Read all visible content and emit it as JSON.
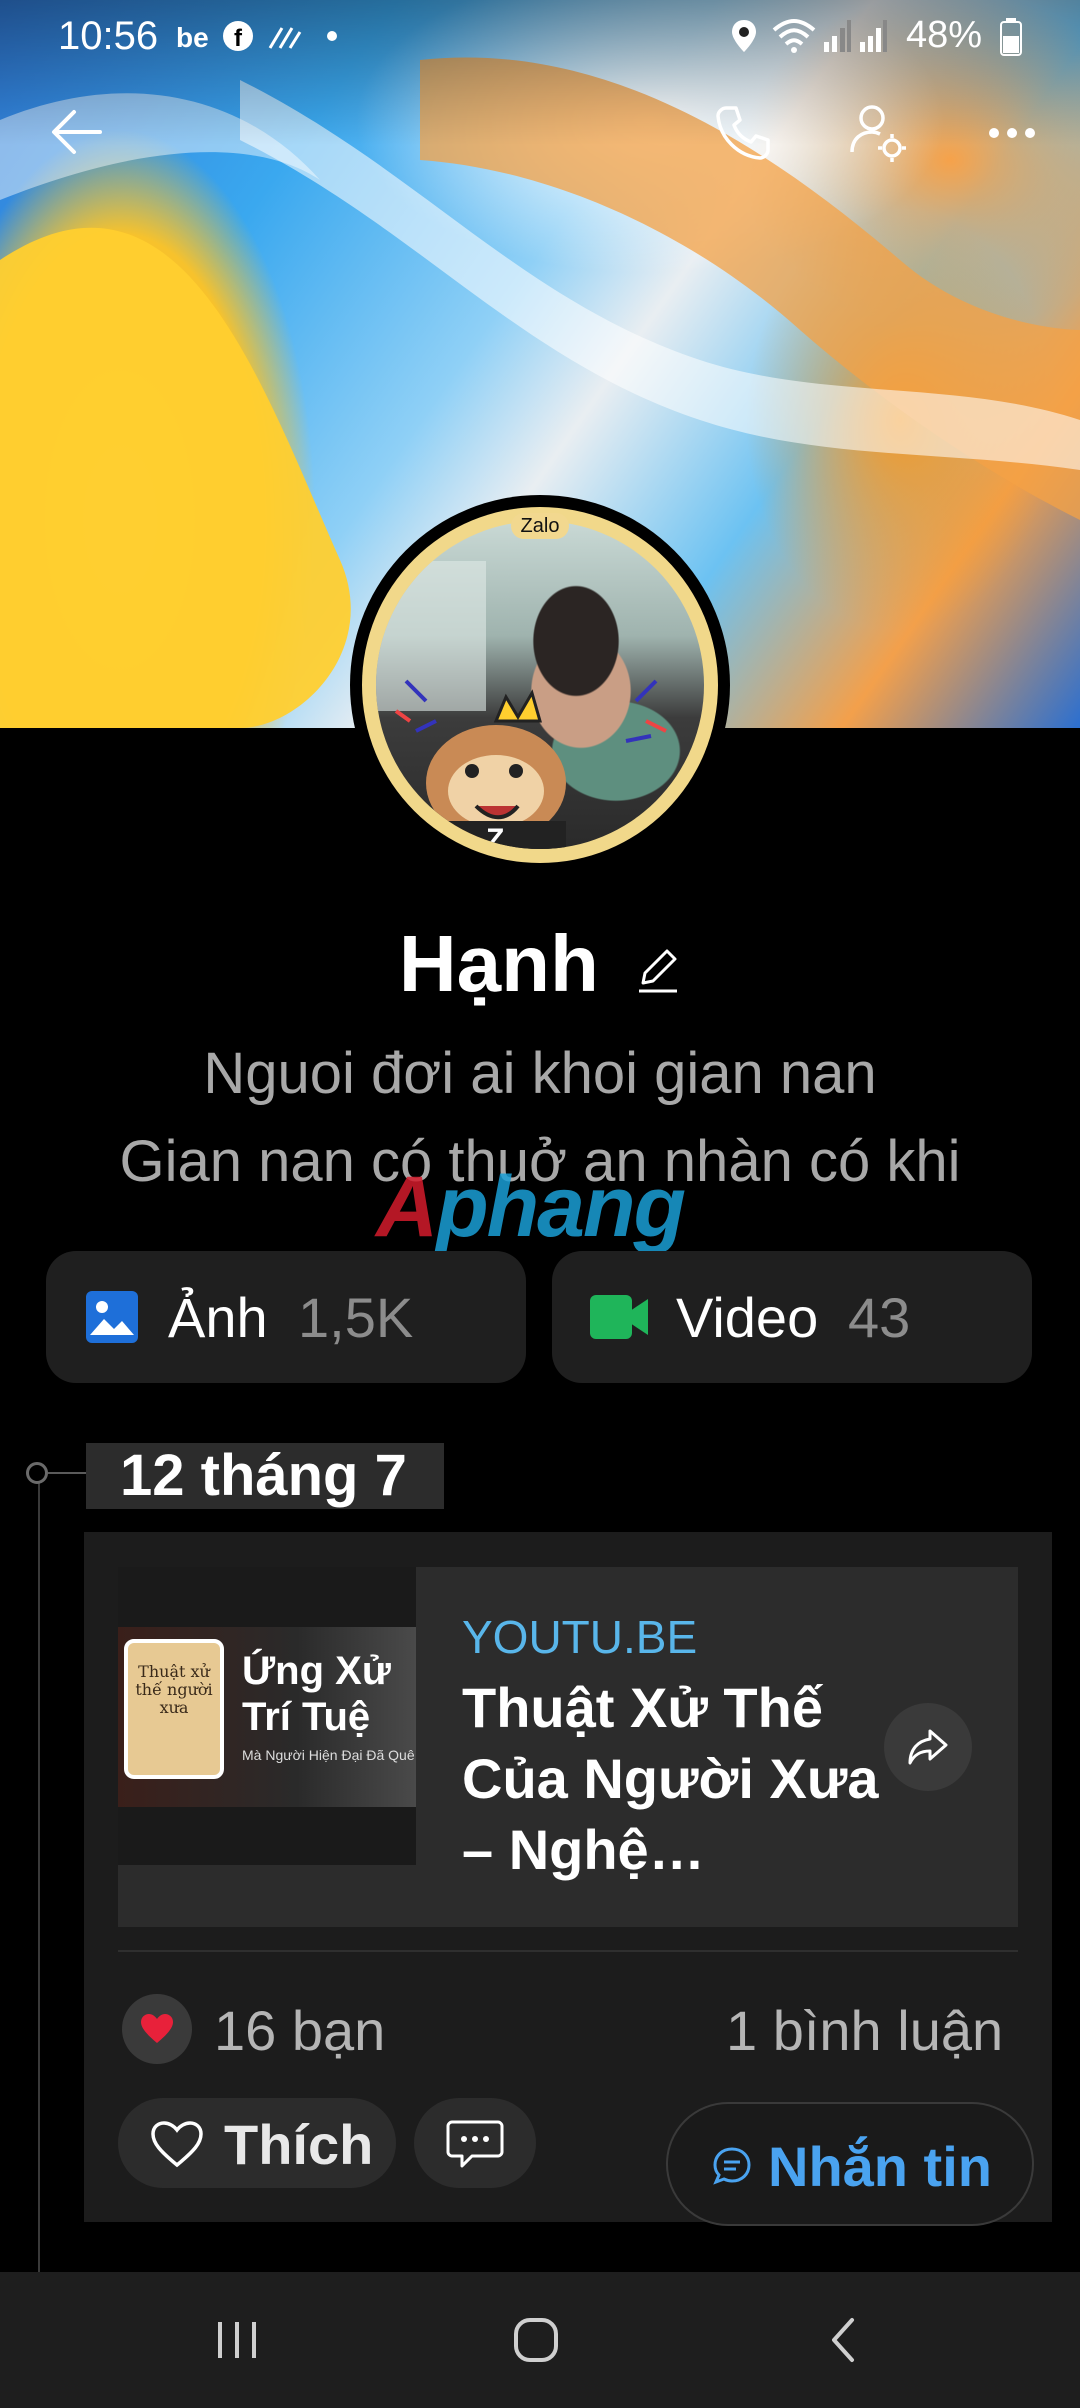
{
  "status_bar": {
    "time": "10:56",
    "battery": "48%",
    "icons_left": [
      "be-icon",
      "facebook-icon",
      "activity-icon",
      "dot-icon"
    ],
    "icons_right": [
      "location-icon",
      "wifi-icon",
      "signal-icon",
      "signal-icon",
      "battery-icon"
    ]
  },
  "profile": {
    "badge": "Zalo",
    "name": "Hạnh",
    "bio_line_1": "Nguoi đơi ai khoi gian nan",
    "bio_line_2": "Gian nan có thuở an nhàn có khi"
  },
  "watermark": {
    "part1": "A",
    "part2": "phang"
  },
  "media": {
    "photos_label": "Ảnh",
    "photos_count": "1,5K",
    "videos_label": "Video",
    "videos_count": "43",
    "photos_icon_color": "#1e6fd9",
    "videos_icon_color": "#1fb55a"
  },
  "timeline": {
    "date": "12 tháng 7"
  },
  "post": {
    "link_domain": "YOUTU.BE",
    "link_title": "Thuật Xử Thế Của Người Xưa – Nghệ…",
    "thumb_text_1": "Ứng Xử",
    "thumb_text_2": "Trí Tuệ",
    "thumb_text_3": "Mà Người Hiện Đại Đã Quê",
    "thumb_book": "Thuật xử thế người xưa",
    "likes": "16 bạn",
    "comments": "1 bình luận",
    "like_label": "Thích",
    "message_label": "Nhắn tin"
  }
}
